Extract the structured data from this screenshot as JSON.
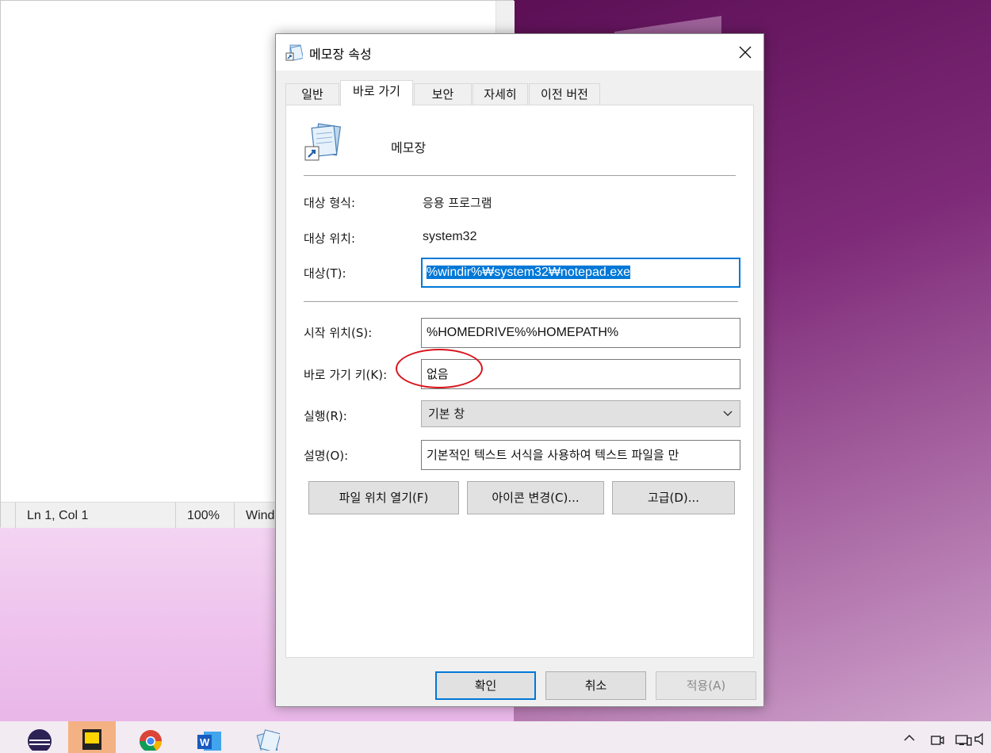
{
  "dialog": {
    "title": "메모장 속성",
    "tabs": [
      {
        "label": "일반",
        "active": false
      },
      {
        "label": "바로 가기",
        "active": true
      },
      {
        "label": "보안",
        "active": false
      },
      {
        "label": "자세히",
        "active": false
      },
      {
        "label": "이전 버전",
        "active": false
      }
    ],
    "app_name": "메모장",
    "target_type_label": "대상 형식:",
    "target_type_value": "응용 프로그램",
    "target_location_label": "대상 위치:",
    "target_location_value": "system32",
    "target_label": "대상(T):",
    "target_value": "%windir%₩system32₩notepad.exe",
    "start_in_label": "시작 위치(S):",
    "start_in_value": "%HOMEDRIVE%%HOMEPATH%",
    "shortcut_key_label": "바로 가기 키(K):",
    "shortcut_key_value": "없음",
    "run_label": "실행(R):",
    "run_value": "기본 창",
    "comment_label": "설명(O):",
    "comment_value": "기본적인 텍스트 서식을 사용하여 텍스트 파일을 만",
    "open_location_button": "파일 위치 열기(F)",
    "change_icon_button": "아이콘 변경(C)...",
    "advanced_button": "고급(D)...",
    "ok_button": "확인",
    "cancel_button": "취소",
    "apply_button": "적용(A)"
  },
  "notepad": {
    "status_position": "Ln 1, Col 1",
    "status_zoom": "100%",
    "status_eol": "Wind"
  },
  "colors": {
    "accent": "#0078d7",
    "annotation": "#d9141d",
    "taskbar_active": "#f4b183"
  },
  "taskbar": {
    "icons": [
      "eclipse-icon",
      "sticky-notes-icon",
      "chrome-icon",
      "word-icon",
      "notepad-icon"
    ],
    "tray_icons": [
      "chevron-up-icon",
      "camera-icon",
      "network-icon",
      "volume-icon"
    ]
  }
}
